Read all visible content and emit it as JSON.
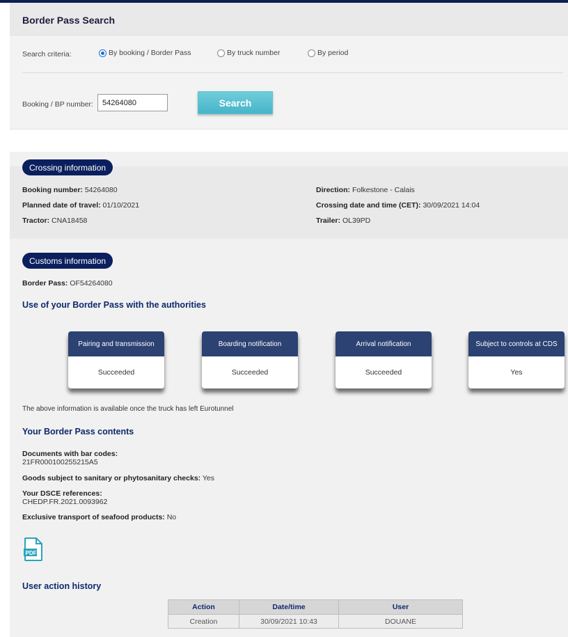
{
  "search": {
    "title": "Border Pass Search",
    "criteria_label": "Search criteria:",
    "options": [
      {
        "label": "By booking / Border Pass",
        "selected": true
      },
      {
        "label": "By truck number",
        "selected": false
      },
      {
        "label": "By period",
        "selected": false
      }
    ],
    "bp_label": "Booking / BP number:",
    "bp_value": "54264080",
    "search_button": "Search"
  },
  "crossing": {
    "title": "Crossing information",
    "booking_number_label": "Booking number:",
    "booking_number": "54264080",
    "planned_date_label": "Planned date of travel:",
    "planned_date": "01/10/2021",
    "tractor_label": "Tractor:",
    "tractor": "CNA18458",
    "direction_label": "Direction:",
    "direction": "Folkestone - Calais",
    "crossing_dt_label": "Crossing date and time (CET):",
    "crossing_dt": "30/09/2021 14:04",
    "trailer_label": "Trailer:",
    "trailer": "OL39PD"
  },
  "customs": {
    "title": "Customs information",
    "border_pass_label": "Border Pass:",
    "border_pass": "OF54264080",
    "authorities_title": "Use of your Border Pass with the authorities",
    "cards": [
      {
        "title": "Pairing and transmission",
        "value": "Succeeded"
      },
      {
        "title": "Boarding notification",
        "value": "Succeeded"
      },
      {
        "title": "Arrival notification",
        "value": "Succeeded"
      },
      {
        "title": "Subject to controls at CDS",
        "value": "Yes"
      }
    ],
    "info_note": "The above information is available once the truck has left Eurotunnel",
    "contents_title": "Your Border Pass contents",
    "documents_label": "Documents with bar codes:",
    "documents_value": "21FR000100255215A5",
    "sanitary_label": "Goods subject to sanitary or phytosanitary checks:",
    "sanitary_value": "Yes",
    "dsce_label": "Your DSCE references:",
    "dsce_value": "CHEDP.FR.2021.0093962",
    "seafood_label": "Exclusive transport of seafood products:",
    "seafood_value": "No",
    "pdf_icon": "pdf-file-icon",
    "history_title": "User action history",
    "history_headers": [
      "Action",
      "Date/time",
      "User"
    ],
    "history_rows": [
      [
        "Creation",
        "30/09/2021 10:43",
        "DOUANE"
      ]
    ]
  },
  "colors": {
    "navy": "#0b1f5e",
    "card_header": "#2c4272",
    "button": "#46b4c9",
    "pdf": "#2aa5b8"
  }
}
